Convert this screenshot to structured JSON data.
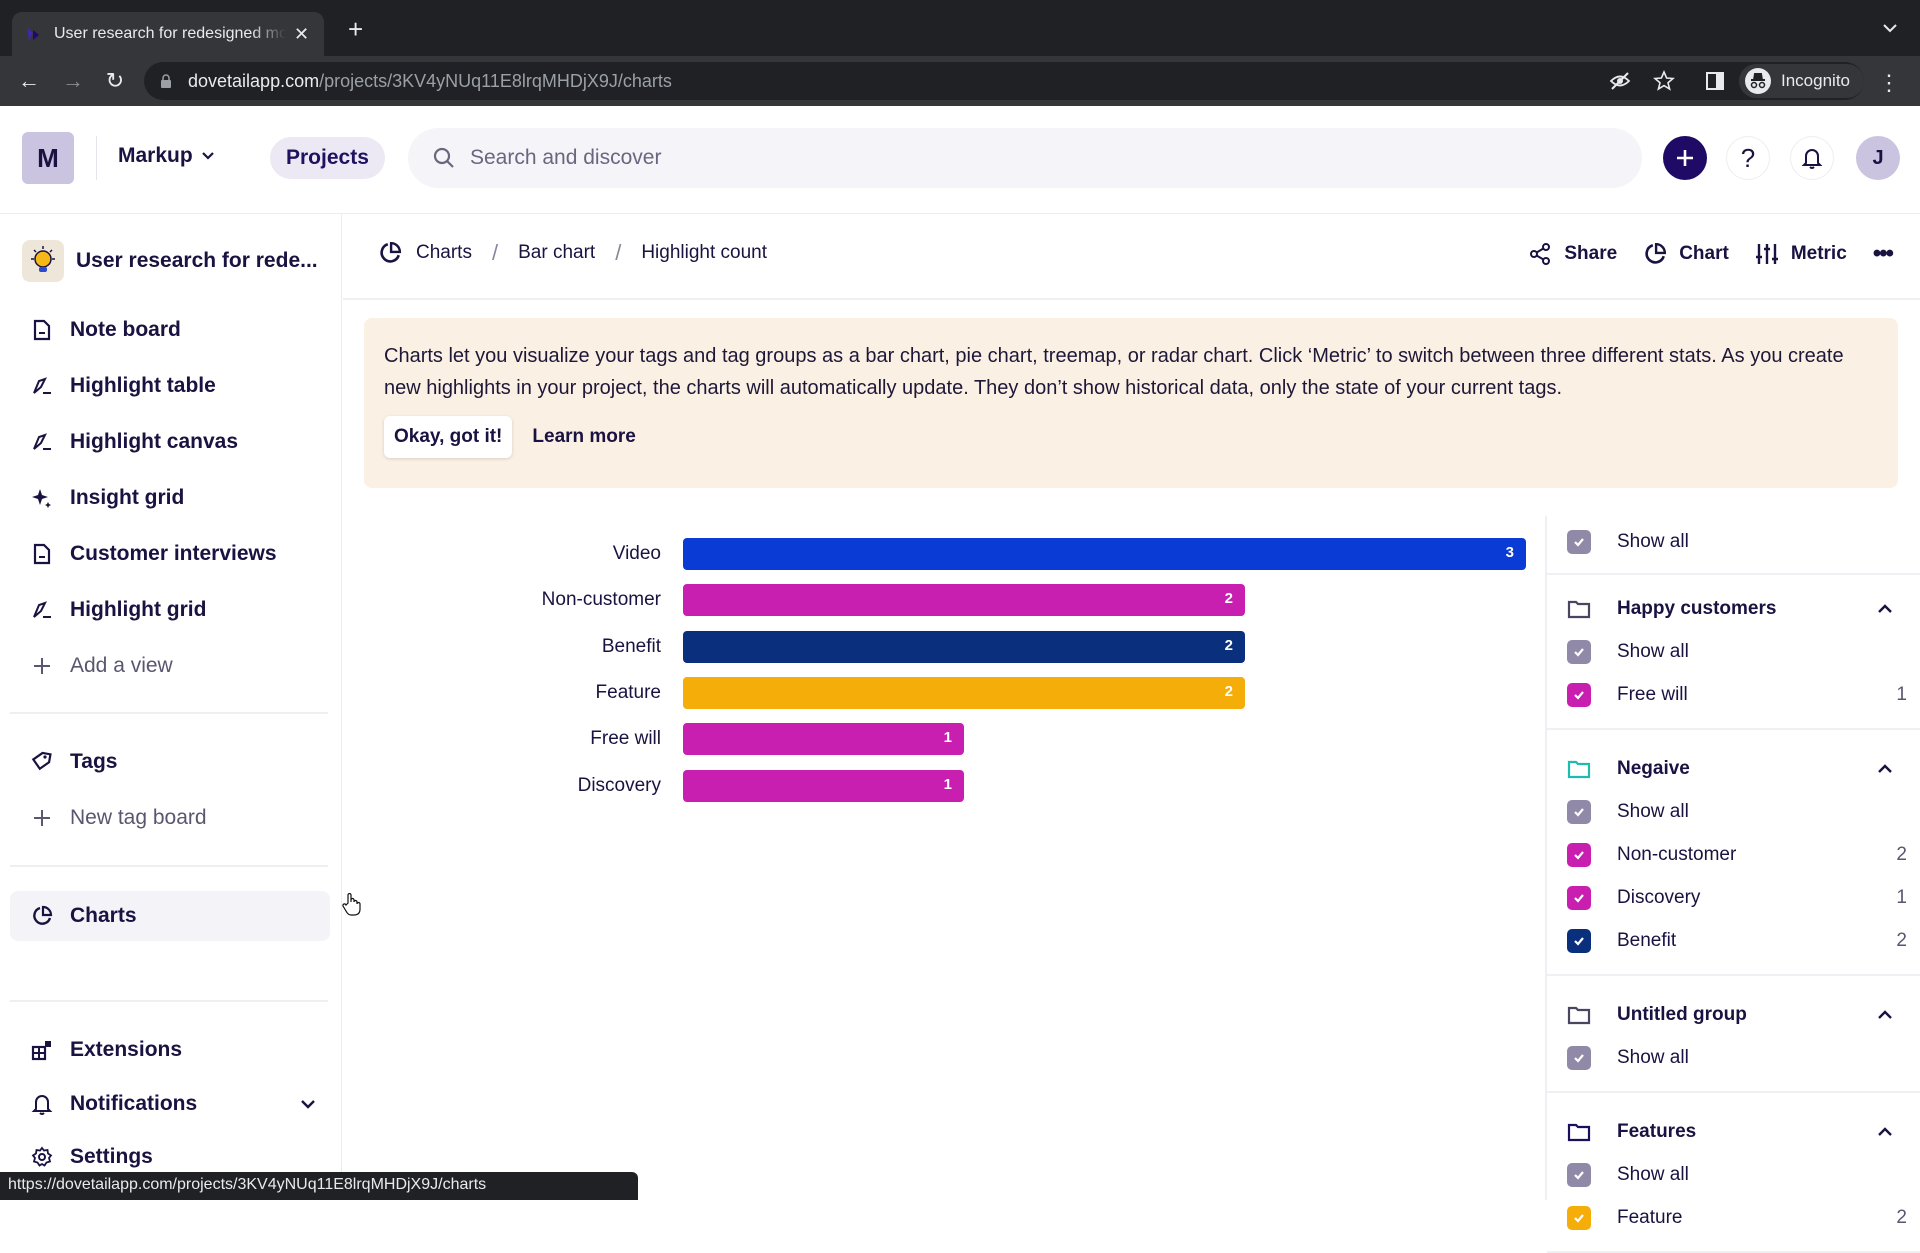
{
  "browser": {
    "tab_title": "User research for redesigned mobile app",
    "url_domain": "dovetailapp.com",
    "url_path": "/projects/3KV4yNUq11E8lrqMHDjX9J/charts",
    "profile_label": "Incognito",
    "status_url": "https://dovetailapp.com/projects/3KV4yNUq11E8lrqMHDjX9J/charts"
  },
  "header": {
    "workspace_initial": "M",
    "workspace_name": "Markup",
    "projects_label": "Projects",
    "search_placeholder": "Search and discover",
    "user_initial": "J"
  },
  "sidebar": {
    "project_name": "User research for rede...",
    "views": [
      {
        "label": "Note board",
        "icon": "note-icon"
      },
      {
        "label": "Highlight table",
        "icon": "highlighter-icon"
      },
      {
        "label": "Highlight canvas",
        "icon": "highlighter-icon"
      },
      {
        "label": "Insight grid",
        "icon": "sparkles-icon"
      },
      {
        "label": "Customer interviews",
        "icon": "note-icon"
      },
      {
        "label": "Highlight grid",
        "icon": "highlighter-icon"
      }
    ],
    "add_view": "Add a view",
    "tags": "Tags",
    "new_tag_board": "New tag board",
    "charts": "Charts",
    "extensions": "Extensions",
    "notifications": "Notifications",
    "settings": "Settings"
  },
  "breadcrumb": [
    "Charts",
    "Bar chart",
    "Highlight count"
  ],
  "actions": {
    "share": "Share",
    "chart": "Chart",
    "metric": "Metric"
  },
  "banner": {
    "text": "Charts let you visualize your tags and tag groups as a bar chart, pie chart, treemap, or radar chart. Click ‘Metric’ to switch between three different stats. As you create new highlights in your project, the charts will automatically update. They don’t show historical data, only the state of your current tags.",
    "ok_label": "Okay, got it!",
    "learn_label": "Learn more"
  },
  "chart_data": {
    "type": "bar",
    "orientation": "horizontal",
    "title": "Highlight count",
    "categories": [
      "Video",
      "Non-customer",
      "Benefit",
      "Feature",
      "Free will",
      "Discovery"
    ],
    "values": [
      3,
      2,
      2,
      2,
      1,
      1
    ],
    "colors": [
      "#0a3bd4",
      "#c81fb0",
      "#0a2f7d",
      "#f5ad0a",
      "#c81fb0",
      "#c81fb0"
    ],
    "xlim": [
      0,
      3
    ],
    "grid": false,
    "data_labels": true
  },
  "filters": {
    "show_all_label": "Show all",
    "groups": [
      {
        "name": "Happy customers",
        "folder_color": "#4a4560",
        "items": [
          {
            "label": "Free will",
            "count": "1",
            "color": "#c81fb0"
          }
        ]
      },
      {
        "name": "Negaive",
        "folder_color": "#1fbab0",
        "items": [
          {
            "label": "Non-customer",
            "count": "2",
            "color": "#c81fb0"
          },
          {
            "label": "Discovery",
            "count": "1",
            "color": "#c81fb0"
          },
          {
            "label": "Benefit",
            "count": "2",
            "color": "#0a2f7d"
          }
        ]
      },
      {
        "name": "Untitled group",
        "folder_color": "#4a4560",
        "items": []
      },
      {
        "name": "Features",
        "folder_color": "#1a0f5c",
        "items": [
          {
            "label": "Feature",
            "count": "2",
            "color": "#f5ad0a"
          }
        ]
      }
    ]
  }
}
